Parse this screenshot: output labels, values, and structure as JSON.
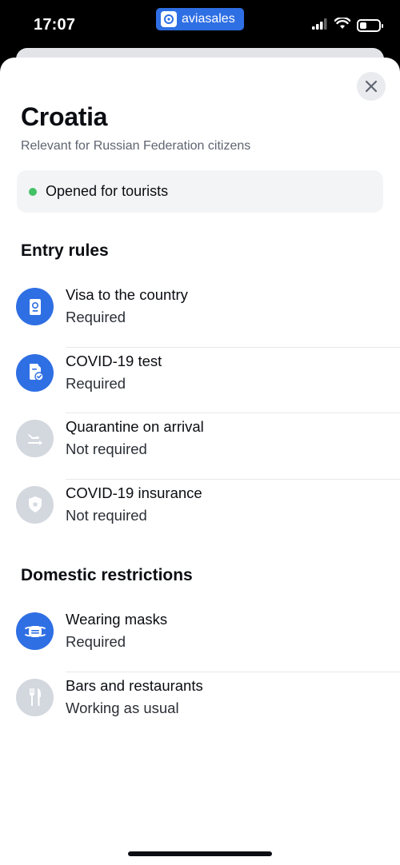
{
  "status_bar": {
    "time": "17:07",
    "app_name": "aviasales"
  },
  "sheet": {
    "title": "Croatia",
    "subtitle": "Relevant for Russian Federation citizens",
    "status": {
      "text": "Opened for tourists",
      "color": "#43c167"
    }
  },
  "entry_rules": {
    "heading": "Entry rules",
    "items": [
      {
        "title": "Visa to the country",
        "value": "Required",
        "icon": "passport-icon",
        "active": true
      },
      {
        "title": "COVID-19 test",
        "value": "Required",
        "icon": "document-check-icon",
        "active": true
      },
      {
        "title": "Quarantine on arrival",
        "value": "Not required",
        "icon": "plane-arrival-icon",
        "active": false
      },
      {
        "title": "COVID-19 insurance",
        "value": "Not required",
        "icon": "shield-star-icon",
        "active": false
      }
    ]
  },
  "domestic": {
    "heading": "Domestic restrictions",
    "items": [
      {
        "title": "Wearing masks",
        "value": "Required",
        "icon": "mask-icon",
        "active": true
      },
      {
        "title": "Bars and restaurants",
        "value": "Working as usual",
        "icon": "fork-knife-icon",
        "active": false
      }
    ]
  },
  "colors": {
    "accent": "#2f6fe4",
    "inactive_icon_bg": "#d3d7de"
  }
}
